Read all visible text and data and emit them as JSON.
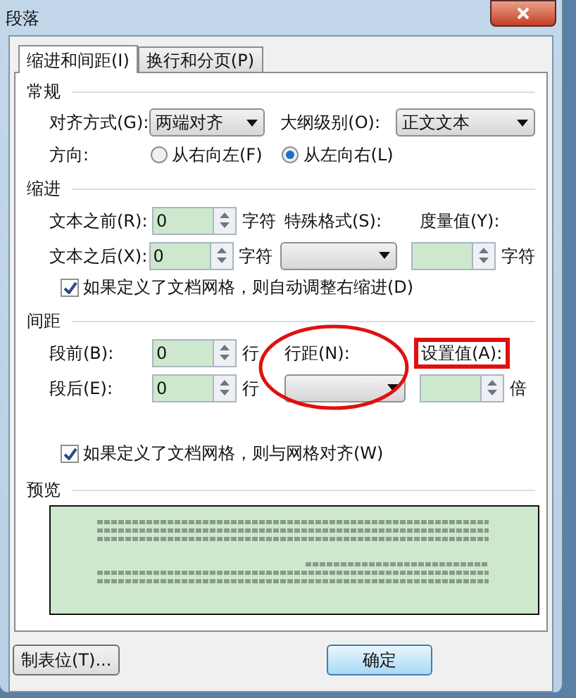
{
  "window": {
    "title": "段落"
  },
  "tabs": [
    {
      "label": "缩进和间距(I)",
      "selected": true
    },
    {
      "label": "换行和分页(P)",
      "selected": false
    }
  ],
  "general": {
    "heading": "常规",
    "alignment": {
      "label": "对齐方式(G):",
      "value": "两端对齐"
    },
    "outline_level": {
      "label": "大纲级别(O):",
      "value": "正文文本"
    },
    "direction": {
      "label": "方向:",
      "options": [
        {
          "label": "从右向左(F)",
          "selected": false
        },
        {
          "label": "从左向右(L)",
          "selected": true
        }
      ]
    }
  },
  "indent": {
    "heading": "缩进",
    "before": {
      "label": "文本之前(R):",
      "value": "0",
      "unit": "字符"
    },
    "after": {
      "label": "文本之后(X):",
      "value": "0",
      "unit": "字符"
    },
    "special": {
      "label": "特殊格式(S):"
    },
    "by": {
      "label": "度量值(Y):",
      "unit": "字符"
    },
    "auto_adjust": {
      "label": "如果定义了文档网格，则自动调整右缩进(D)",
      "checked": true
    }
  },
  "spacing": {
    "heading": "间距",
    "before": {
      "label": "段前(B):",
      "value": "0",
      "unit": "行"
    },
    "after": {
      "label": "段后(E):",
      "value": "0",
      "unit": "行"
    },
    "line_spacing": {
      "label": "行距(N):"
    },
    "at": {
      "label": "设置值(A):",
      "unit": "倍"
    },
    "snap": {
      "label": "如果定义了文档网格，则与网格对齐(W)",
      "checked": true
    }
  },
  "preview": {
    "heading": "预览"
  },
  "buttons": [
    {
      "label": "制表位(T)..."
    },
    {
      "label": "确定"
    }
  ]
}
